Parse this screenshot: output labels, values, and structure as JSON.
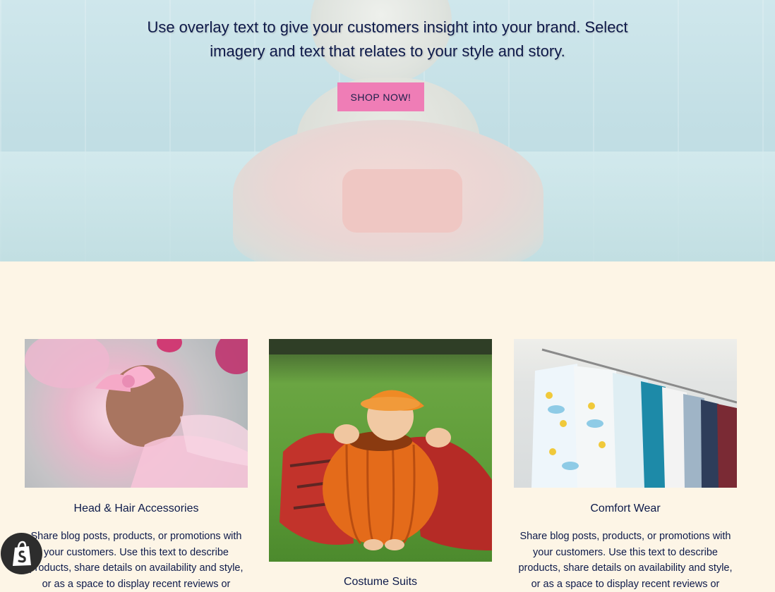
{
  "hero": {
    "text": "Use overlay text to give your customers insight into your brand. Select imagery and text that relates to your style and story.",
    "button_label": "SHOP NOW!"
  },
  "collections": [
    {
      "title": "Head & Hair Accessories",
      "description": "Share blog posts, products, or promotions with your customers. Use this text to describe products, share details on availability and style, or as a space to display recent reviews or"
    },
    {
      "title": "Costume Suits",
      "description": ""
    },
    {
      "title": "Comfort Wear",
      "description": "Share blog posts, products, or promotions with your customers. Use this text to describe products, share details on availability and style, or as a space to display recent reviews or"
    }
  ],
  "colors": {
    "navy": "#0d1a4a",
    "button_pink": "#ef7db6",
    "cream": "#fdf5e6"
  },
  "badge": {
    "icon": "shopify-bag-icon"
  }
}
